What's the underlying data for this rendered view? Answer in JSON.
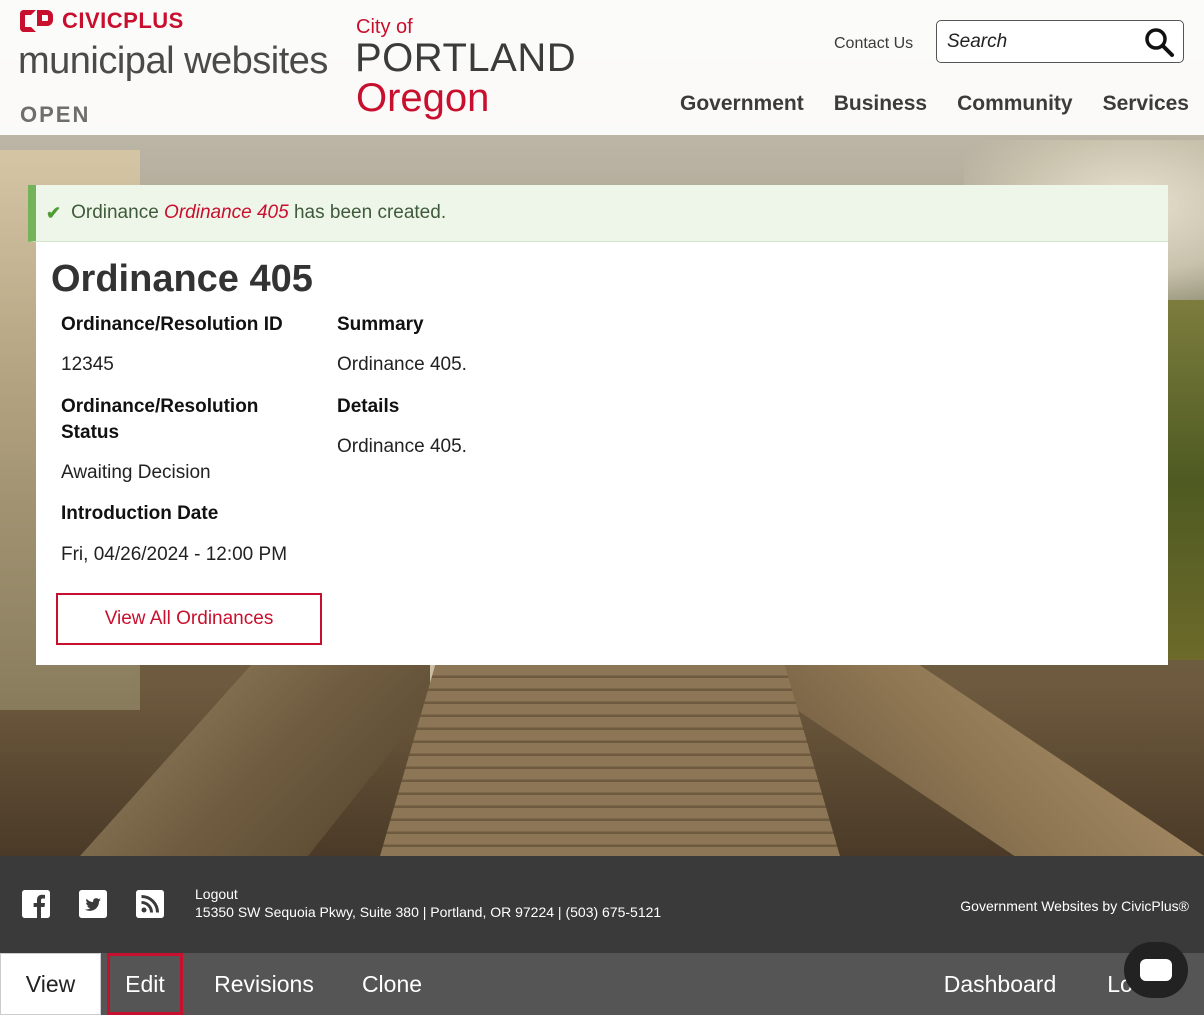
{
  "header": {
    "civicplus_label": "CIVICPLUS",
    "product_label": "municipal websites",
    "open_label": "OPEN",
    "city_of": "City of",
    "city_name": "PORTLAND",
    "state_name": "Oregon",
    "contact_label": "Contact Us",
    "search_placeholder": "Search",
    "nav": [
      "Government",
      "Business",
      "Community",
      "Services"
    ]
  },
  "alert": {
    "prefix": "Ordinance",
    "item": "Ordinance 405",
    "suffix": "has been created."
  },
  "ordinance": {
    "title": "Ordinance 405",
    "id_label": "Ordinance/Resolution ID",
    "id_value": "12345",
    "status_label": "Ordinance/Resolution Status",
    "status_value": "Awaiting Decision",
    "intro_label": "Introduction Date",
    "intro_value": "Fri, 04/26/2024 - 12:00 PM",
    "summary_label": "Summary",
    "summary_value": "Ordinance 405.",
    "details_label": "Details",
    "details_value": "Ordinance 405.",
    "view_all_label": "View All Ordinances"
  },
  "footer": {
    "social_icons": [
      "facebook-icon",
      "twitter-icon",
      "rss-icon"
    ],
    "logout_label": "Logout",
    "address": "15350 SW Sequoia Pkwy, Suite 380 | Portland, OR 97224 | (503) 675-5121",
    "credit": "Government Websites by CivicPlus®"
  },
  "admin_tabs": {
    "view": "View",
    "edit": "Edit",
    "revisions": "Revisions",
    "clone": "Clone",
    "dashboard": "Dashboard",
    "logout_partial": "Lo"
  },
  "colors": {
    "brand_red": "#c8102e",
    "alert_green": "#74b35a",
    "footer_bg": "#3a3a3a",
    "tabbar_bg": "#555555"
  }
}
